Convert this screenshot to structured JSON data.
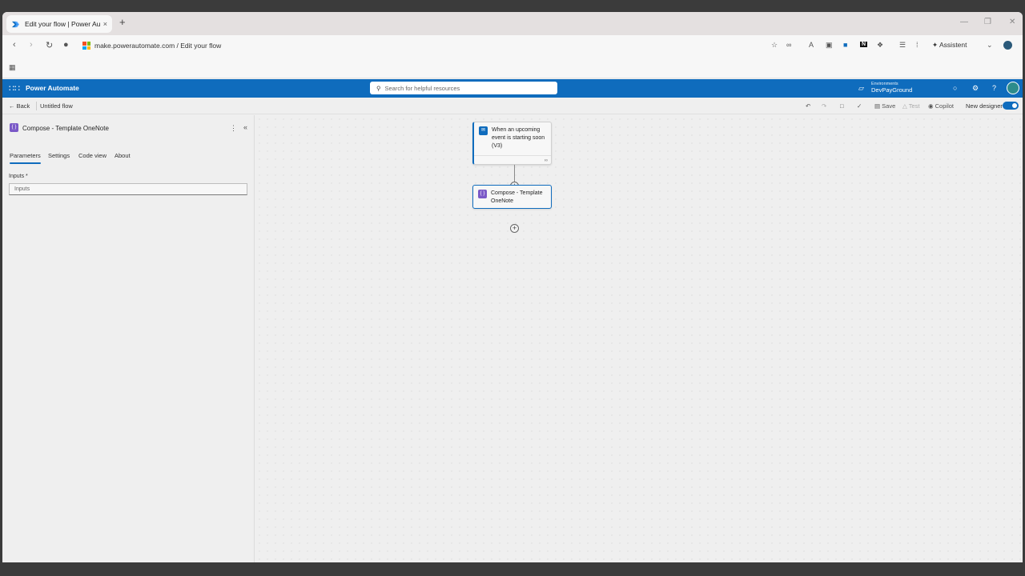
{
  "browser": {
    "tab_title": "Edit your flow | Power Autom",
    "tab_close": "×",
    "new_tab": "+",
    "url": "make.powerautomate.com / Edit your flow",
    "assistant_label": "Assistent",
    "extension_badge": "N",
    "win_min": "—",
    "win_max": "❐",
    "win_close": "✕"
  },
  "header": {
    "app_name": "Power Automate",
    "search_placeholder": "Search for helpful resources",
    "environment_label": "Environments",
    "environment_name": "DevPayGround"
  },
  "commandbar": {
    "back_label": "Back",
    "flow_name": "Untitled flow",
    "save_label": "Save",
    "test_label": "Test",
    "copilot_label": "Copilot",
    "new_designer_label": "New designer",
    "new_designer_on": true
  },
  "panel": {
    "title": "Compose - Template OneNote",
    "tabs": [
      {
        "label": "Parameters",
        "active": true
      },
      {
        "label": "Settings",
        "active": false
      },
      {
        "label": "Code view",
        "active": false
      },
      {
        "label": "About",
        "active": false
      }
    ],
    "field_label": "Inputs *",
    "field_placeholder": "Inputs"
  },
  "canvas": {
    "trigger": {
      "label": "When an upcoming event is starting soon (V3)",
      "icon": "outlook-icon",
      "color": "#0f6cbd"
    },
    "action": {
      "label": "Compose - Template OneNote",
      "icon": "compose-icon",
      "color": "#7a59c7"
    }
  },
  "colors": {
    "accent": "#0f6cbd",
    "compose": "#7a59c7"
  }
}
